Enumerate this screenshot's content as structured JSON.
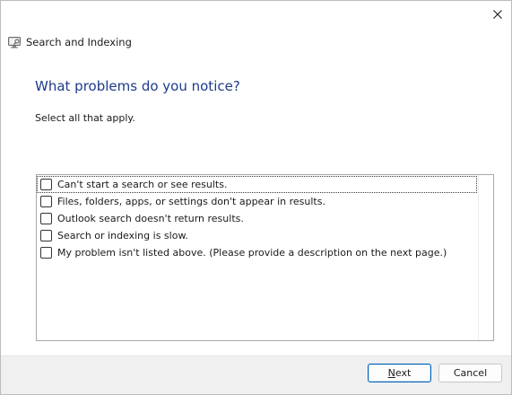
{
  "window": {
    "title": "Search and Indexing",
    "close_icon": "close-icon",
    "app_icon": "troubleshooter-icon"
  },
  "main": {
    "heading": "What problems do you notice?",
    "instruction": "Select all that apply."
  },
  "problems": [
    {
      "label": "Can't start a search or see results.",
      "checked": false,
      "focused": true
    },
    {
      "label": "Files, folders, apps, or settings don't appear in results.",
      "checked": false,
      "focused": false
    },
    {
      "label": "Outlook search doesn't return results.",
      "checked": false,
      "focused": false
    },
    {
      "label": "Search or indexing is slow.",
      "checked": false,
      "focused": false
    },
    {
      "label": "My problem isn't listed above. (Please provide a description on the next page.)",
      "checked": false,
      "focused": false
    }
  ],
  "footer": {
    "next_accel": "N",
    "next_rest": "ext",
    "cancel_label": "Cancel"
  },
  "colors": {
    "heading": "#1e3a8a",
    "primary_border": "#005fb8",
    "footer_bg": "#f0f0f0"
  }
}
